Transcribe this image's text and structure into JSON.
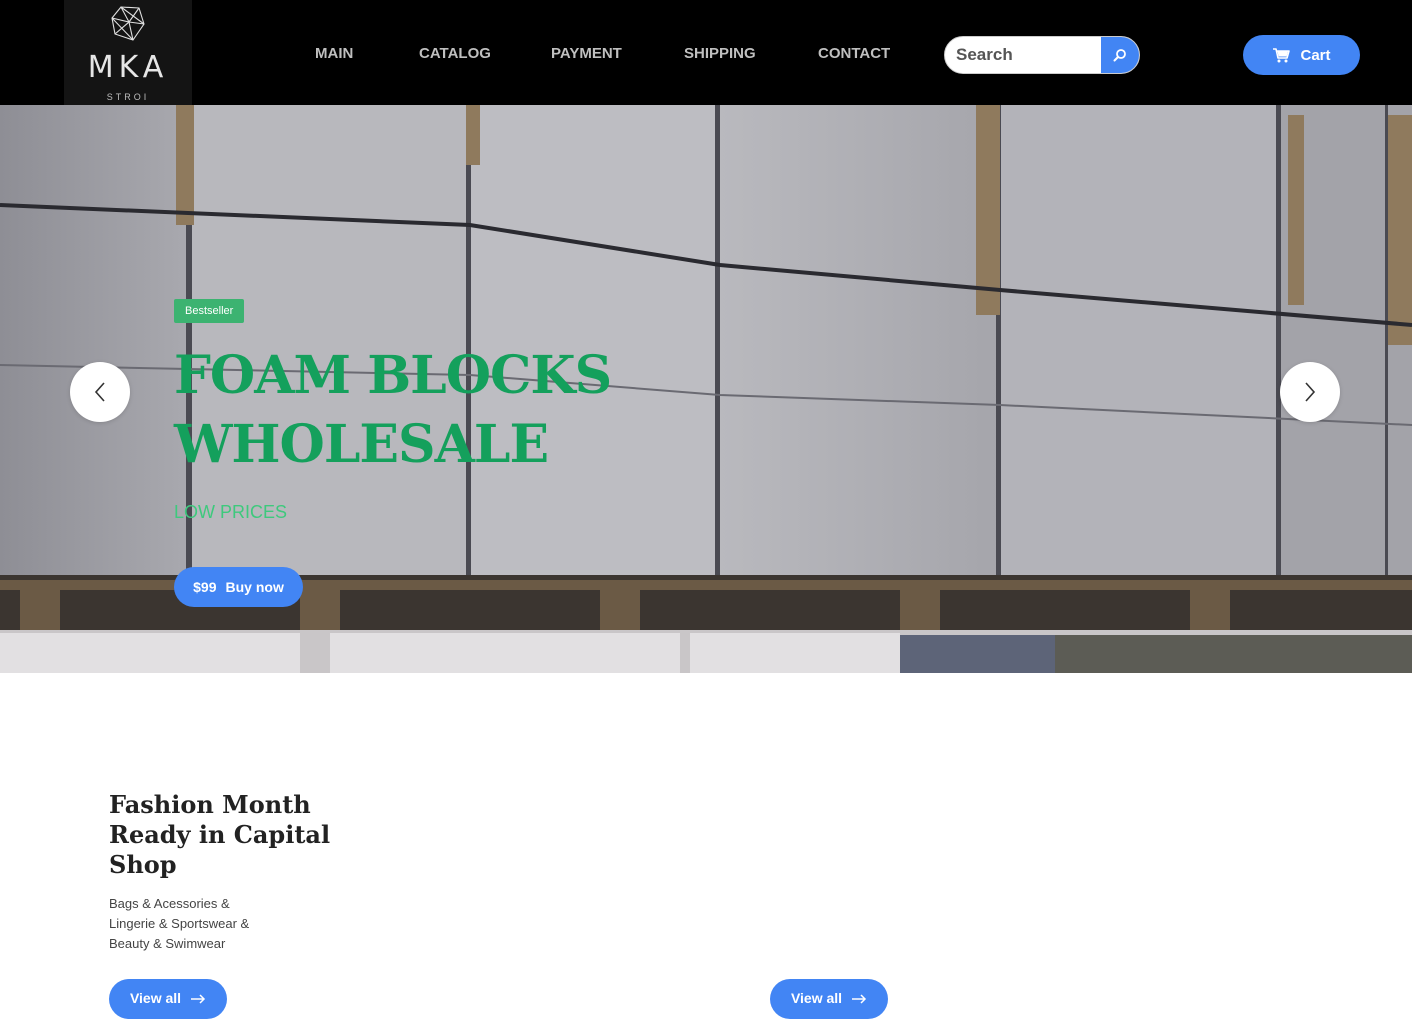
{
  "brand": {
    "name": "MKA",
    "tagline": "STROI",
    "logo_icon": "polyhedron-icon"
  },
  "nav": {
    "items": [
      {
        "label": "MAIN"
      },
      {
        "label": "CATALOG"
      },
      {
        "label": "PAYMENT"
      },
      {
        "label": "SHIPPING"
      },
      {
        "label": "CONTACT"
      }
    ]
  },
  "search": {
    "placeholder": "Search",
    "value": "",
    "icon": "search-icon"
  },
  "cart": {
    "label": "Cart",
    "icon": "cart-icon"
  },
  "hero": {
    "badge": "Bestseller",
    "title": "FOAM BLOCKS WHOLESALE",
    "subtitle": "LOW PRICES",
    "price": "$99",
    "button_label": "Buy now",
    "prev_icon": "chevron-left-icon",
    "next_icon": "chevron-right-icon"
  },
  "promo": {
    "title": "Fashion Month Ready in Capital Shop",
    "text": "Bags & Acessories & Lingerie & Sportswear & Beauty & Swimwear",
    "view_all": "View all",
    "view_all_2": "View all",
    "arrow_icon": "arrow-right-icon"
  },
  "colors": {
    "accent": "#4285f4",
    "badge": "#3cb371",
    "hero_title": "#14a05c",
    "header_bg": "#000000"
  }
}
